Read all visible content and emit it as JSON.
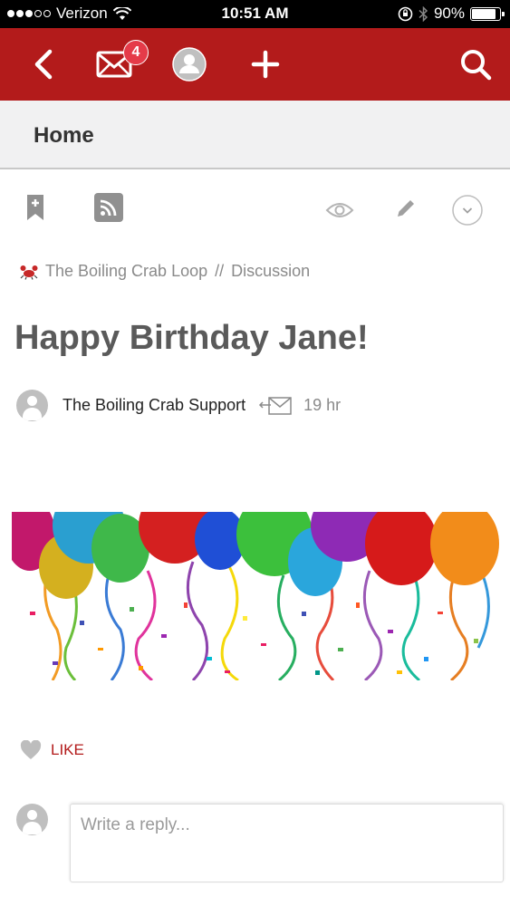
{
  "status_bar": {
    "carrier": "Verizon",
    "time": "10:51 AM",
    "battery": "90%",
    "battery_level": 0.9
  },
  "navbar": {
    "inbox_badge": "4",
    "background": "#b31b1b"
  },
  "home_bar": {
    "title": "Home"
  },
  "post": {
    "community": "The Boiling Crab Loop",
    "separator": "//",
    "category": "Discussion",
    "title": "Happy Birthday Jane!",
    "author": "The Boiling Crab Support",
    "time": "19 hr"
  },
  "actions": {
    "like_label": "LIKE"
  },
  "reply": {
    "placeholder": "Write a reply..."
  },
  "icons": [
    "back-icon",
    "mail-icon",
    "profile-icon",
    "plus-icon",
    "search-icon",
    "bookmark-icon",
    "rss-icon",
    "eye-icon",
    "pencil-icon",
    "chevron-down-icon",
    "crab-icon",
    "share-mail-icon",
    "heart-icon"
  ]
}
